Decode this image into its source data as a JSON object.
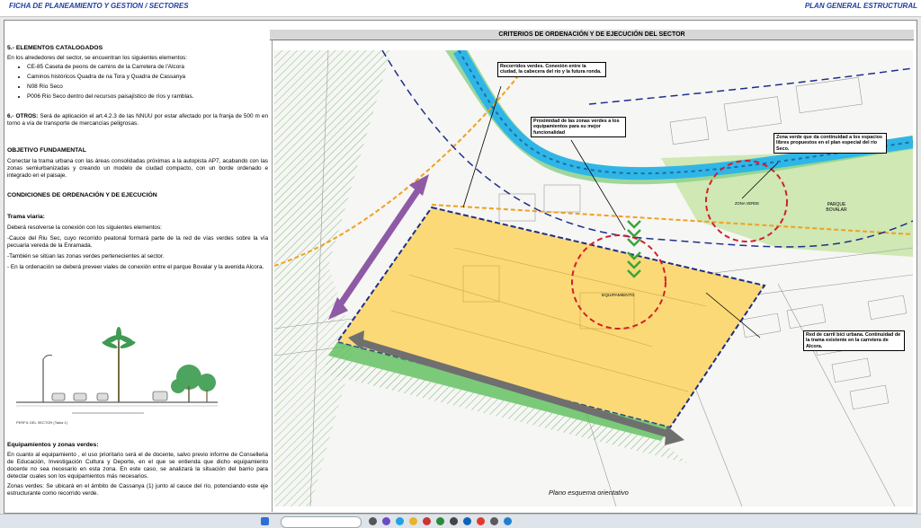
{
  "header": {
    "left_title": "FICHA DE PLANEAMIENTO Y GESTION / SECTORES",
    "right_title": "PLAN GENERAL ESTRUCTURAL"
  },
  "band_title": "CRITERIOS DE ORDENACIÓN Y DE EJECUCIÓN DEL SECTOR",
  "left": {
    "s5_title": "5.- ELEMENTOS CATALOGADOS",
    "s5_intro": "En los alrededores del sector, se encuentran los siguientes elementos:",
    "s5_items": [
      "CE-85 Caseta de peons de camins de la Carretera de l'Alcora",
      "Caminos históricos Quadra de na Tora y Quadra de Cassanya",
      "N08 Río Seco",
      "P006 Río Seco dentro del recursos paisajístico de ríos y ramblas."
    ],
    "s6_label": "6.- OTROS:",
    "s6_text": " Será de aplicación el art.4.2.3 de las NNUU por estar afectado por la franja de 500 m en torno a vía de transporte de mercancías peligrosas.",
    "obj_title": "OBJETIVO FUNDAMENTAL",
    "obj_text": "Conectar la trama urbana con las áreas consolidadas próximas a la autopista AP7, acabando con las zonas semiurbanizadas y creando un modelo de ciudad compacto, con un borde ordenado e integrado en el paisaje.",
    "cond_title": "CONDICIONES DE  ORDENACIÓN Y DE EJECUCIÓN",
    "trama_title": "Trama viaria:",
    "trama_intro": "Deberá resolverse la conexión con los siguientes elementos:",
    "trama_p1": "-Cauce del Riu Sec, cuyo recorrido peatonal formará parte de la red de vías verdes sobre la vía pecuaria vereda de la Enramada.",
    "trama_p2": "-También se sitúan las zonas verdes pertenecientes al sector.",
    "trama_p3": "- En la ordenación se deberá preveer viales de conexión entre el parque Bovalar y la avenida Alcora.",
    "section_caption": "PERFIL DEL SECTOR (Tabla 1)",
    "equip_title": "Equipamientos y zonas verdes:",
    "equip_text": "En cuanto al equipamiento , el uso prioritario será el de docente, salvo previo informe de Conselleria de Educación, Investigación Cultura y Deporte, en el que se entienda que dicho equipamiento docente no sea necesario en esta zona. En este caso, se analizará la situación del barrio para detectar cuales son los equipamientos más necesarios.",
    "zonas_text": "Zonas verdes: Se ubicará en el ámbito de Cassanya (1) junto al cauce del río, potenciando este eje estructurante como recorrido verde."
  },
  "map": {
    "callouts": {
      "recorridos": "Recorridos verdes. Conexión entre la ciudad, la cabecera del río y la futura ronda.",
      "proximidad": "Proximidad de las zonas verdes a los equipamientos para su mejor funcionalidad",
      "zona_verde": "Zona verde que da continuidad a los espacios libres propuestos en el plan especial del río Seco.",
      "carril_bici": "Red de carril bici urbana. Continuidad de la trama existente en la carretera de Alcora."
    },
    "place_labels": {
      "equipamiento": "EQUIPAMIENTO",
      "parque": "PARQUE BOVALAR",
      "zona_verde_small": "ZONA VERDE"
    },
    "caption": "Plano esquema orientativo",
    "colors": {
      "sector": "#fbd977",
      "river": "#2fb6e6",
      "green": "#cfe8b4",
      "arrow_purple": "#8e5aa5",
      "arrow_grey": "#6f6f6f",
      "circle_red": "#d21f2b"
    }
  }
}
